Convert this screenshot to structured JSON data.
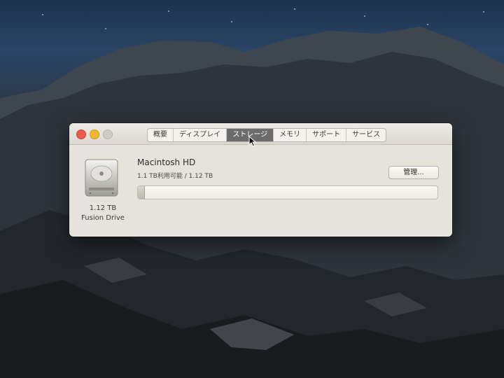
{
  "window": {
    "tabs": [
      {
        "label": "概要",
        "active": false
      },
      {
        "label": "ディスプレイ",
        "active": false
      },
      {
        "label": "ストレージ",
        "active": true
      },
      {
        "label": "メモリ",
        "active": false
      },
      {
        "label": "サポート",
        "active": false
      },
      {
        "label": "サービス",
        "active": false
      }
    ]
  },
  "storage": {
    "drive_icon": "hard-drive-icon",
    "drive_size": "1.12 TB",
    "drive_type": "Fusion Drive",
    "disk_name": "Macintosh HD",
    "availability": "1.1 TB利用可能 / 1.12 TB",
    "used_fraction": 0.02,
    "manage_label": "管理..."
  },
  "colors": {
    "active_tab": "#6c6c6c",
    "close": "#ec5a52",
    "minimize": "#f2b632",
    "zoom_disabled": "#cfccc6"
  }
}
